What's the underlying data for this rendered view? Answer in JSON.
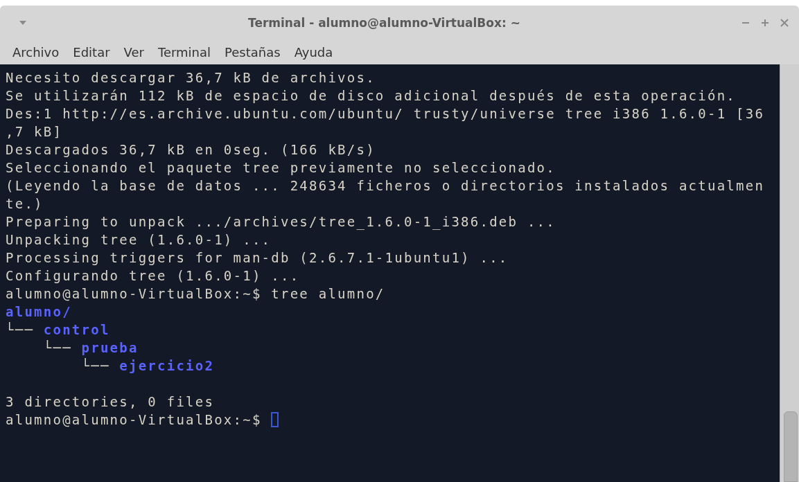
{
  "window": {
    "title": "Terminal - alumno@alumno-VirtualBox: ~"
  },
  "menu": [
    "Archivo",
    "Editar",
    "Ver",
    "Terminal",
    "Pestañas",
    "Ayuda"
  ],
  "terminal": {
    "lines": [
      {
        "kind": "text",
        "text": "Necesito descargar 36,7 kB de archivos."
      },
      {
        "kind": "text",
        "text": "Se utilizarán 112 kB de espacio de disco adicional después de esta operación."
      },
      {
        "kind": "text",
        "text": "Des:1 http://es.archive.ubuntu.com/ubuntu/ trusty/universe tree i386 1.6.0-1 [36"
      },
      {
        "kind": "text",
        "text": ",7 kB]"
      },
      {
        "kind": "text",
        "text": "Descargados 36,7 kB en 0seg. (166 kB/s)"
      },
      {
        "kind": "text",
        "text": "Seleccionando el paquete tree previamente no seleccionado."
      },
      {
        "kind": "text",
        "text": "(Leyendo la base de datos ... 248634 ficheros o directorios instalados actualmen"
      },
      {
        "kind": "text",
        "text": "te.)"
      },
      {
        "kind": "text",
        "text": "Preparing to unpack .../archives/tree_1.6.0-1_i386.deb ..."
      },
      {
        "kind": "text",
        "text": "Unpacking tree (1.6.0-1) ..."
      },
      {
        "kind": "text",
        "text": "Processing triggers for man-db (2.6.7.1-1ubuntu1) ..."
      },
      {
        "kind": "text",
        "text": "Configurando tree (1.6.0-1) ..."
      },
      {
        "kind": "text",
        "text": "alumno@alumno-VirtualBox:~$ tree alumno/"
      },
      {
        "kind": "dir",
        "text": "alumno/"
      },
      {
        "kind": "tree",
        "prefix": "└── ",
        "text": "control"
      },
      {
        "kind": "tree",
        "prefix": "    └── ",
        "text": "prueba"
      },
      {
        "kind": "tree",
        "prefix": "        └── ",
        "text": "ejercicio2"
      },
      {
        "kind": "blank"
      },
      {
        "kind": "text",
        "text": "3 directories, 0 files"
      },
      {
        "kind": "prompt",
        "text": "alumno@alumno-VirtualBox:~$ "
      }
    ]
  }
}
